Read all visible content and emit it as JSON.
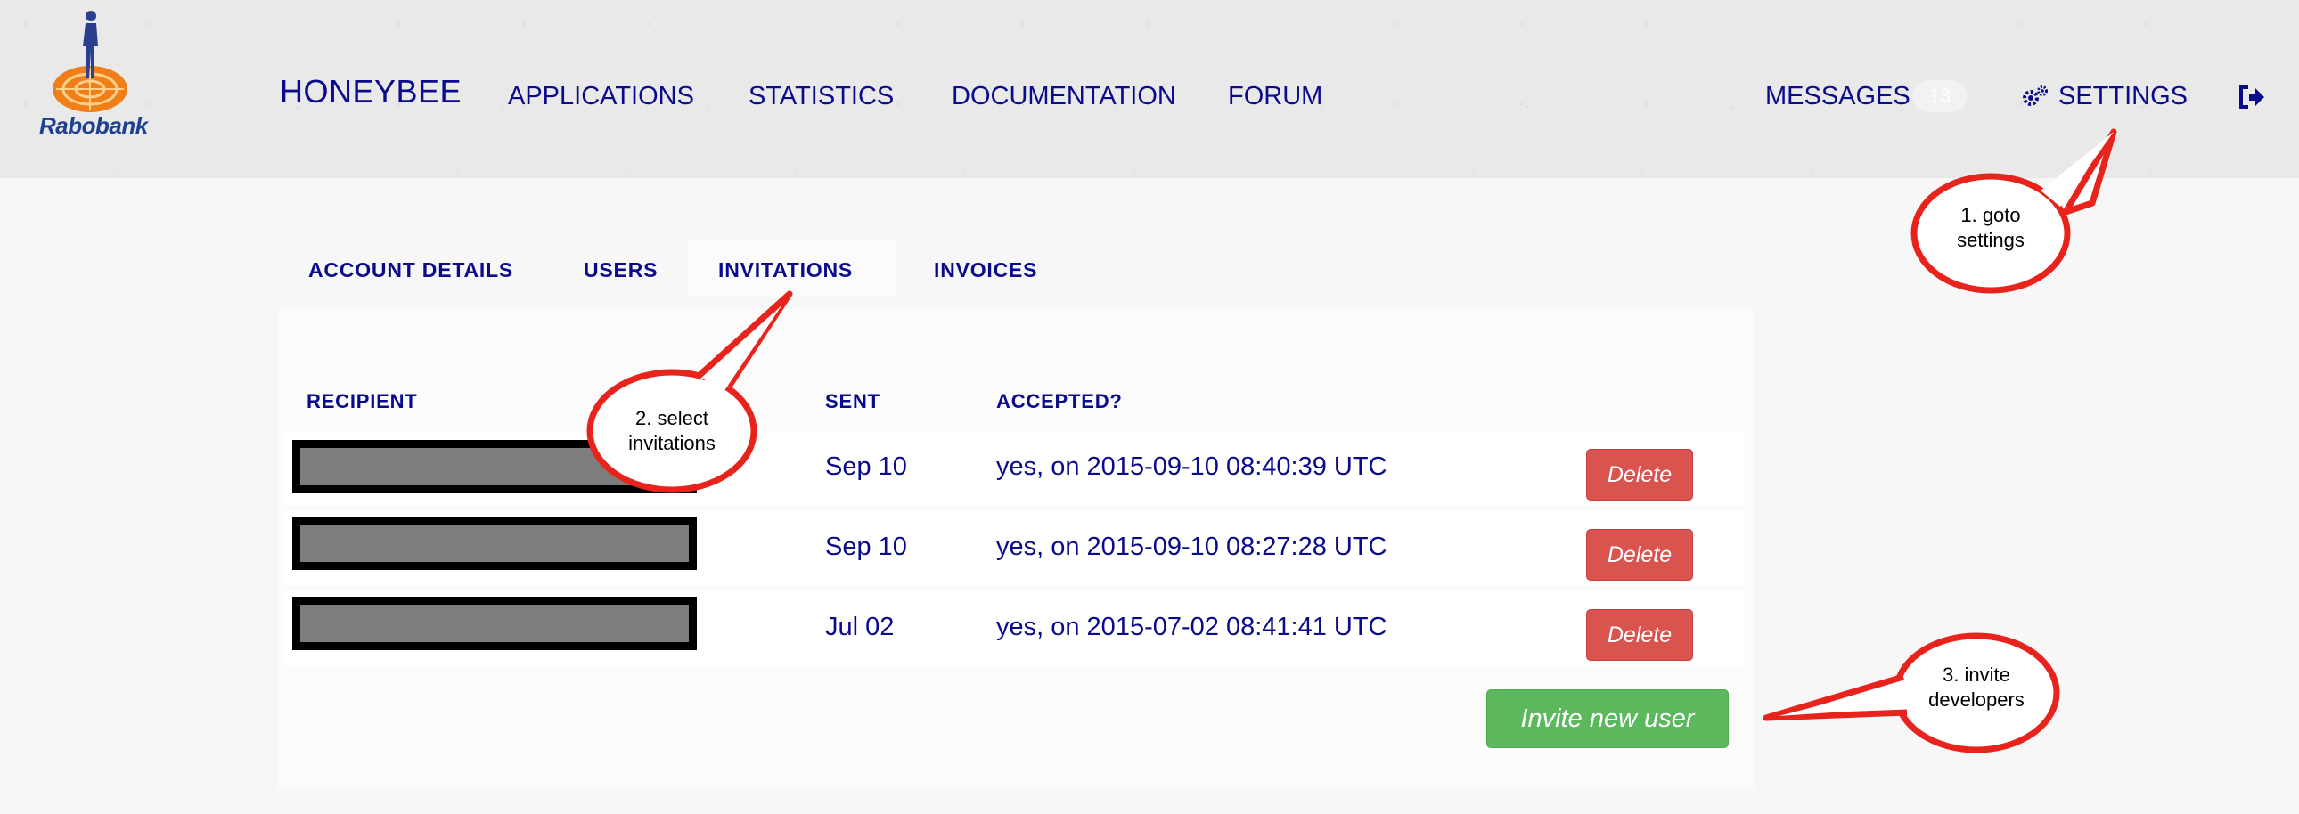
{
  "header": {
    "logo_text": "Rabobank",
    "brand": "HONEYBEE",
    "nav": [
      "APPLICATIONS",
      "STATISTICS",
      "DOCUMENTATION",
      "FORUM"
    ],
    "messages_label": "MESSAGES",
    "messages_count": "13",
    "settings_label": "SETTINGS",
    "icons": {
      "settings": "gear-icon",
      "logout": "logout-icon"
    }
  },
  "tabs": [
    "ACCOUNT DETAILS",
    "USERS",
    "INVITATIONS",
    "INVOICES"
  ],
  "active_tab": "INVITATIONS",
  "table": {
    "columns": [
      "RECIPIENT",
      "SENT",
      "ACCEPTED?"
    ],
    "rows": [
      {
        "sent": "Sep 10",
        "accepted": "yes, on 2015-09-10 08:40:39 UTC",
        "action": "Delete"
      },
      {
        "sent": "Sep 10",
        "accepted": "yes, on 2015-09-10 08:27:28 UTC",
        "action": "Delete"
      },
      {
        "sent": "Jul 02",
        "accepted": "yes, on 2015-07-02 08:41:41 UTC",
        "action": "Delete"
      }
    ]
  },
  "invite_button": "Invite new user",
  "callouts": {
    "one_line1": "1. goto",
    "one_line2": "settings",
    "two_line1": "2. select",
    "two_line2": "invitations",
    "three_line1": "3. invite",
    "three_line2": "developers"
  },
  "colors": {
    "nav_text": "#0a0a8c",
    "delete": "#d9534f",
    "invite": "#5cb85c",
    "callout": "#e8231c"
  }
}
